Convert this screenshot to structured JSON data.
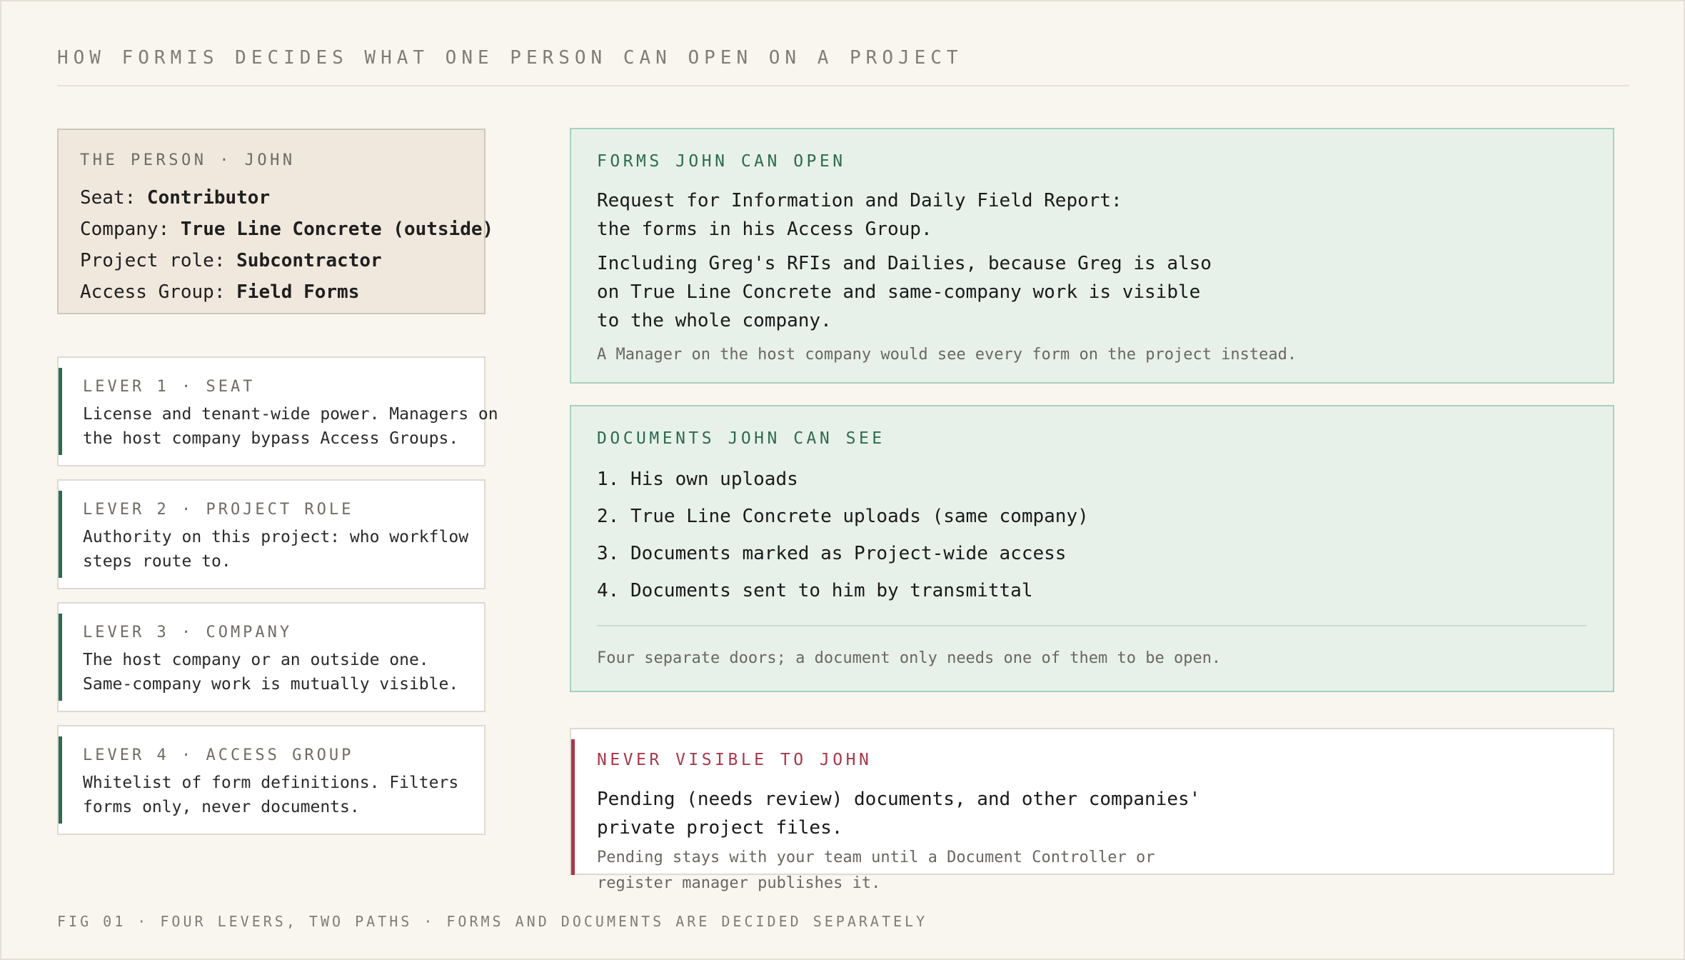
{
  "title": "HOW FORMIS DECIDES WHAT ONE PERSON CAN OPEN ON A PROJECT",
  "person": {
    "label": "THE PERSON · JOHN",
    "rows": [
      {
        "key": "Seat: ",
        "value": "Contributor"
      },
      {
        "key": "Company: ",
        "value": "True Line Concrete (outside)"
      },
      {
        "key": "Project role: ",
        "value": "Subcontractor"
      },
      {
        "key": "Access Group: ",
        "value": "Field Forms"
      }
    ]
  },
  "levers": [
    {
      "label": "LEVER 1 · SEAT",
      "line1": "License and tenant-wide power. Managers on",
      "line2": "the host company bypass Access Groups."
    },
    {
      "label": "LEVER 2 · PROJECT ROLE",
      "line1": "Authority on this project: who workflow",
      "line2": "steps route to."
    },
    {
      "label": "LEVER 3 · COMPANY",
      "line1": "The host company or an outside one.",
      "line2": "Same-company work is mutually visible."
    },
    {
      "label": "LEVER 4 · ACCESS GROUP",
      "line1": "Whitelist of form definitions. Filters",
      "line2": "forms only, never documents."
    }
  ],
  "forms": {
    "label": "FORMS JOHN CAN OPEN",
    "lines": [
      "Request for Information and Daily Field Report:",
      "the forms in his Access Group.",
      "Including Greg's RFIs and Dailies, because Greg is also",
      "on True Line Concrete and same-company work is visible",
      "to the whole company."
    ],
    "note": "A Manager on the host company would see every form on the project instead."
  },
  "documents": {
    "label": "DOCUMENTS JOHN CAN SEE",
    "items": [
      "1. His own uploads",
      "2. True Line Concrete uploads (same company)",
      "3. Documents marked as Project-wide access",
      "4. Documents sent to him by transmittal"
    ],
    "note": "Four separate doors; a document only needs one of them to be open."
  },
  "never": {
    "label": "NEVER VISIBLE TO JOHN",
    "lines": [
      "Pending (needs review) documents, and other companies'",
      "private project files."
    ],
    "notes": [
      "Pending stays with your team until a Document Controller or",
      "register manager publishes it."
    ]
  },
  "caption": "FIG 01 · FOUR LEVERS, TWO PATHS · FORMS AND DOCUMENTS ARE DECIDED SEPARATELY",
  "colors": {
    "background": "#f9f6ef",
    "accent_green": "#2e6b4f",
    "accent_red": "#a8384a",
    "panel_green": "#e7f1ea",
    "person_panel": "#f0e8dd"
  }
}
